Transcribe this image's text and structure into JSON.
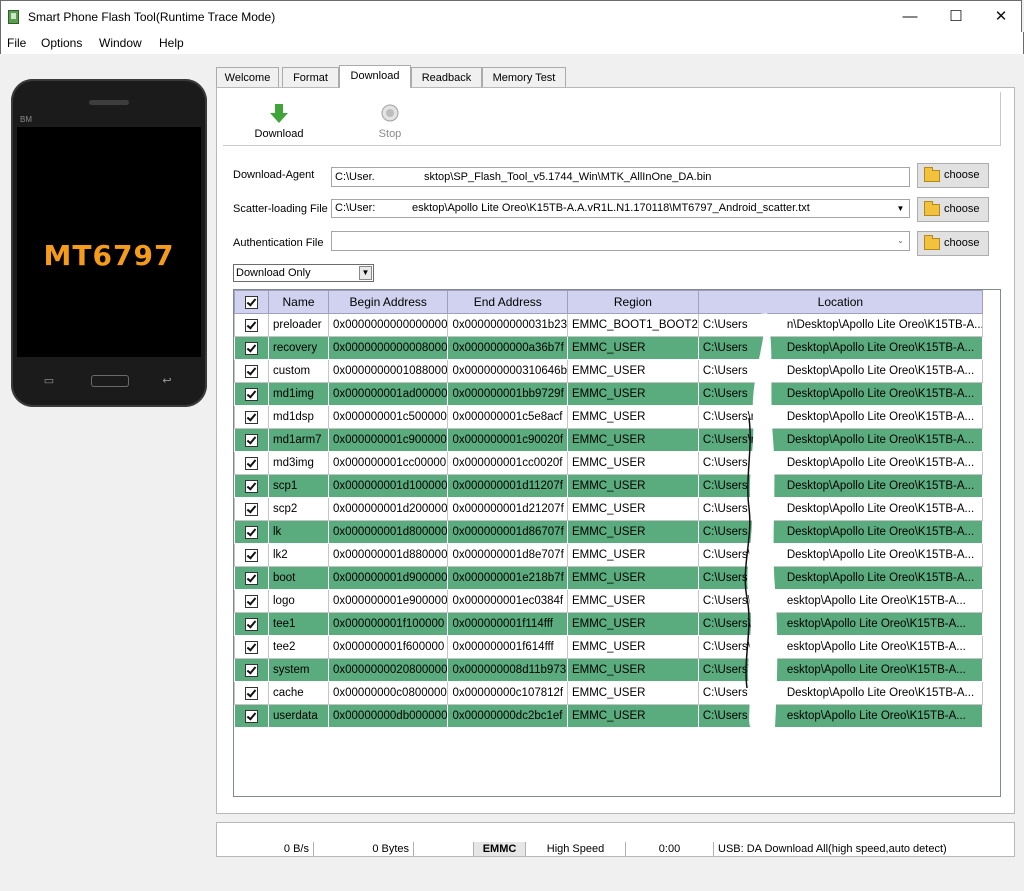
{
  "window": {
    "title": "Smart Phone Flash Tool(Runtime Trace Mode)",
    "minimize": "—",
    "maximize": "☐",
    "close": "✕"
  },
  "menu": [
    "File",
    "Options",
    "Window",
    "Help"
  ],
  "phone": {
    "brand": "BM",
    "chip": "MT6797"
  },
  "tabs": [
    "Welcome",
    "Format",
    "Download",
    "Readback",
    "Memory Test"
  ],
  "active_tab": "Download",
  "toolbar": {
    "download": "Download",
    "stop": "Stop"
  },
  "fields": {
    "download_agent_label": "Download-Agent",
    "download_agent_prefix": "C:\\User.",
    "download_agent_value": "sktop\\SP_Flash_Tool_v5.1744_Win\\MTK_AllInOne_DA.bin",
    "scatter_label": "Scatter-loading File",
    "scatter_prefix": "C:\\User:",
    "scatter_value": "esktop\\Apollo Lite Oreo\\K15TB-A.A.vR1L.N1.170118\\MT6797_Android_scatter.txt",
    "auth_label": "Authentication File",
    "auth_value": "",
    "choose": "choose"
  },
  "mode": "Download Only",
  "table": {
    "headers": [
      "Name",
      "Begin Address",
      "End Address",
      "Region",
      "Location"
    ],
    "rows": [
      {
        "name": "preloader",
        "begin": "0x0000000000000000",
        "end": "0x0000000000031b23",
        "region": "EMMC_BOOT1_BOOT2",
        "loc_a": "C:\\Users",
        "loc_b": "n\\Desktop\\Apollo Lite Oreo\\K15TB-A..."
      },
      {
        "name": "recovery",
        "begin": "0x0000000000008000",
        "end": "0x0000000000a36b7f",
        "region": "EMMC_USER",
        "loc_a": "C:\\Users",
        "loc_b": "Desktop\\Apollo Lite Oreo\\K15TB-A..."
      },
      {
        "name": "custom",
        "begin": "0x0000000001088000",
        "end": "0x000000000310646b",
        "region": "EMMC_USER",
        "loc_a": "C:\\Users",
        "loc_b": "Desktop\\Apollo Lite Oreo\\K15TB-A..."
      },
      {
        "name": "md1img",
        "begin": "0x000000001ad00000",
        "end": "0x000000001bb9729f",
        "region": "EMMC_USER",
        "loc_a": "C:\\Users",
        "loc_b": "Desktop\\Apollo Lite Oreo\\K15TB-A..."
      },
      {
        "name": "md1dsp",
        "begin": "0x000000001c500000",
        "end": "0x000000001c5e8acf",
        "region": "EMMC_USER",
        "loc_a": "C:\\Users\\ra",
        "loc_b": "Desktop\\Apollo Lite Oreo\\K15TB-A..."
      },
      {
        "name": "md1arm7",
        "begin": "0x000000001c900000",
        "end": "0x000000001c90020f",
        "region": "EMMC_USER",
        "loc_a": "C:\\Users\\ra",
        "loc_b": "Desktop\\Apollo Lite Oreo\\K15TB-A..."
      },
      {
        "name": "md3img",
        "begin": "0x000000001cc00000",
        "end": "0x000000001cc0020f",
        "region": "EMMC_USER",
        "loc_a": "C:\\Users",
        "loc_b": "Desktop\\Apollo Lite Oreo\\K15TB-A..."
      },
      {
        "name": "scp1",
        "begin": "0x000000001d100000",
        "end": "0x000000001d11207f",
        "region": "EMMC_USER",
        "loc_a": "C:\\Users",
        "loc_b": "Desktop\\Apollo Lite Oreo\\K15TB-A..."
      },
      {
        "name": "scp2",
        "begin": "0x000000001d200000",
        "end": "0x000000001d21207f",
        "region": "EMMC_USER",
        "loc_a": "C:\\Users",
        "loc_b": "Desktop\\Apollo Lite Oreo\\K15TB-A..."
      },
      {
        "name": "lk",
        "begin": "0x000000001d800000",
        "end": "0x000000001d86707f",
        "region": "EMMC_USER",
        "loc_a": "C:\\Users",
        "loc_b": "Desktop\\Apollo Lite Oreo\\K15TB-A..."
      },
      {
        "name": "lk2",
        "begin": "0x000000001d880000",
        "end": "0x000000001d8e707f",
        "region": "EMMC_USER",
        "loc_a": "C:\\Users\\r",
        "loc_b": "Desktop\\Apollo Lite Oreo\\K15TB-A..."
      },
      {
        "name": "boot",
        "begin": "0x000000001d900000",
        "end": "0x000000001e218b7f",
        "region": "EMMC_USER",
        "loc_a": "C:\\Users",
        "loc_b": "Desktop\\Apollo Lite Oreo\\K15TB-A..."
      },
      {
        "name": "logo",
        "begin": "0x000000001e900000",
        "end": "0x000000001ec0384f",
        "region": "EMMC_USER",
        "loc_a": "C:\\Users\\",
        "loc_b": "esktop\\Apollo Lite Oreo\\K15TB-A..."
      },
      {
        "name": "tee1",
        "begin": "0x000000001f100000",
        "end": "0x000000001f114fff",
        "region": "EMMC_USER",
        "loc_a": "C:\\Users\\",
        "loc_b": "esktop\\Apollo Lite Oreo\\K15TB-A..."
      },
      {
        "name": "tee2",
        "begin": "0x000000001f600000",
        "end": "0x000000001f614fff",
        "region": "EMMC_USER",
        "loc_a": "C:\\Users\\",
        "loc_b": "esktop\\Apollo Lite Oreo\\K15TB-A..."
      },
      {
        "name": "system",
        "begin": "0x0000000020800000",
        "end": "0x000000008d11b973",
        "region": "EMMC_USER",
        "loc_a": "C:\\Users\\",
        "loc_b": "esktop\\Apollo Lite Oreo\\K15TB-A..."
      },
      {
        "name": "cache",
        "begin": "0x00000000c0800000",
        "end": "0x00000000c107812f",
        "region": "EMMC_USER",
        "loc_a": "C:\\Users",
        "loc_b": "Desktop\\Apollo Lite Oreo\\K15TB-A..."
      },
      {
        "name": "userdata",
        "begin": "0x00000000db000000",
        "end": "0x00000000dc2bc1ef",
        "region": "EMMC_USER",
        "loc_a": "C:\\Users",
        "loc_b": "esktop\\Apollo Lite Oreo\\K15TB-A..."
      }
    ]
  },
  "status": {
    "speed": "0 B/s",
    "bytes": "0 Bytes",
    "storage": "EMMC",
    "mode": "High Speed",
    "time": "0:00",
    "usb": "USB: DA Download All(high speed,auto detect)"
  },
  "colors": {
    "alt_row": "#5aab7e",
    "header": "#d1d1f0",
    "chip_text": "#f59b1a"
  }
}
